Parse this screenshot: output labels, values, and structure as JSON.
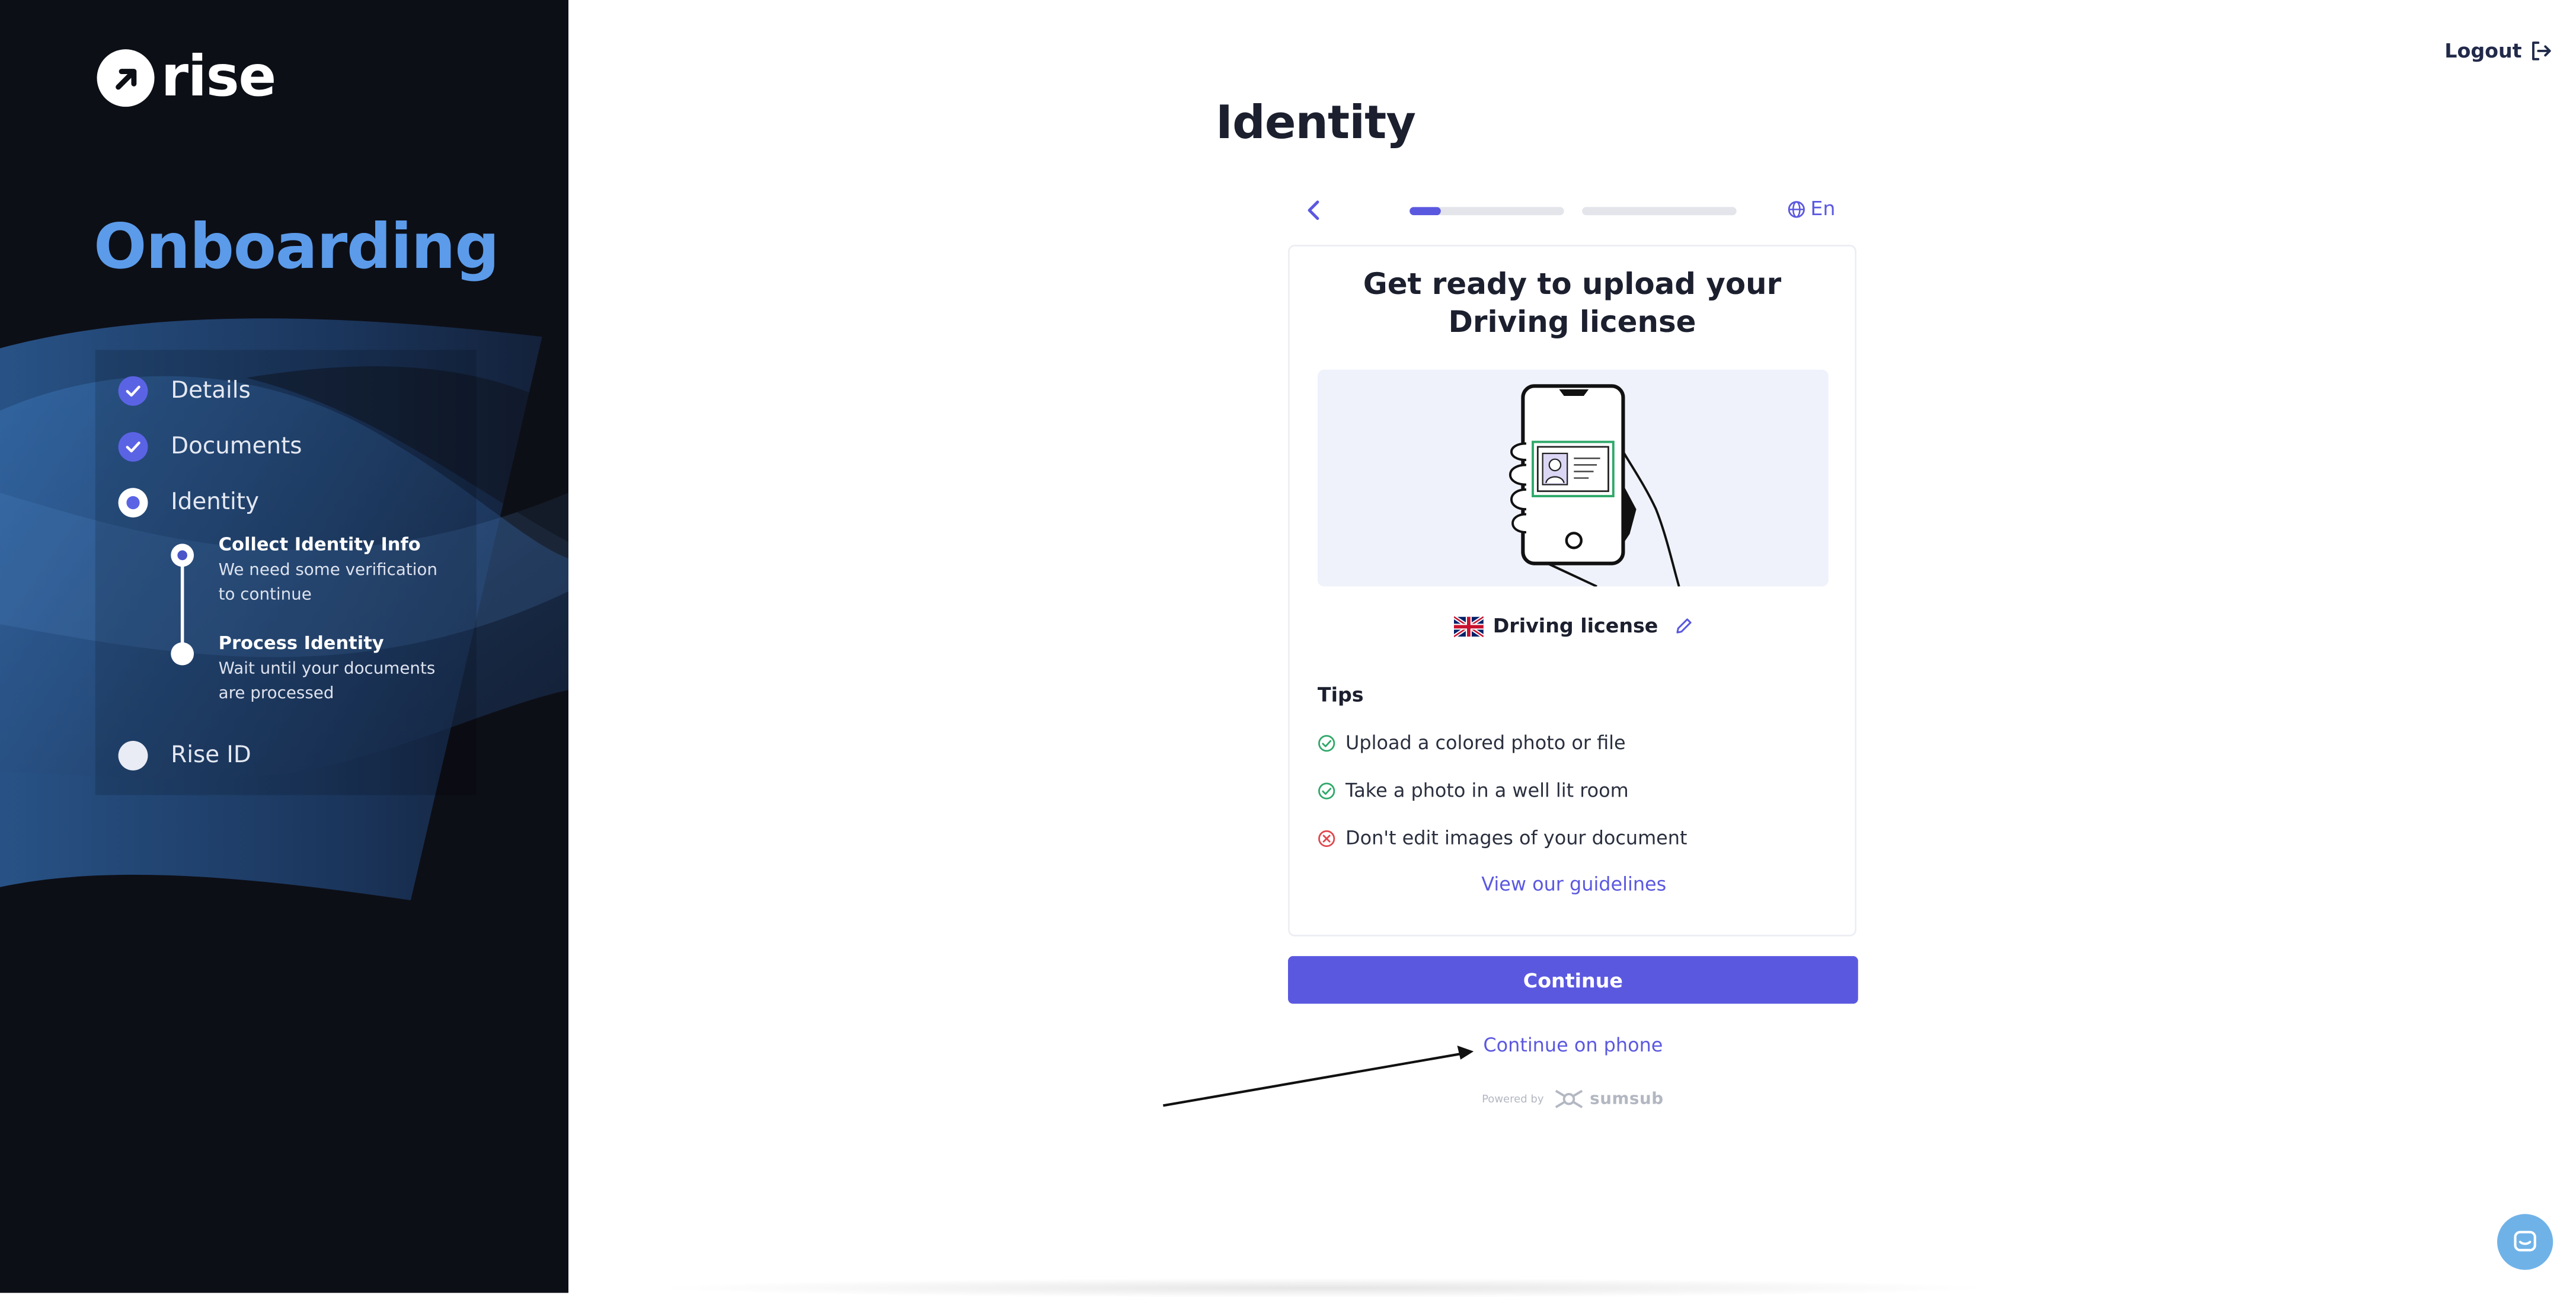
{
  "sidebar": {
    "logo_text": "rise",
    "title": "Onboarding",
    "steps": [
      {
        "label": "Details",
        "state": "done"
      },
      {
        "label": "Documents",
        "state": "done"
      },
      {
        "label": "Identity",
        "state": "current"
      },
      {
        "label": "Rise ID",
        "state": "todo"
      }
    ],
    "substeps": [
      {
        "title": "Collect Identity Info",
        "description": "We need some verification to continue",
        "state": "current"
      },
      {
        "title": "Process Identity",
        "description": "Wait until your documents are processed",
        "state": "todo"
      }
    ]
  },
  "header": {
    "logout_label": "Logout",
    "page_title": "Identity"
  },
  "verification": {
    "language": "En",
    "progress": [
      0.2,
      0
    ],
    "heading": "Get ready to upload your Driving license",
    "document_type": "Driving license",
    "tips_title": "Tips",
    "tips": [
      {
        "text": "Upload a colored photo or file",
        "type": "do"
      },
      {
        "text": "Take a photo in a well lit room",
        "type": "do"
      },
      {
        "text": "Don't edit images of your document",
        "type": "dont"
      }
    ],
    "guidelines_link": "View our guidelines",
    "continue_label": "Continue",
    "continue_phone_label": "Continue on phone",
    "powered_by": "Powered by",
    "provider": "sumsub"
  },
  "colors": {
    "sidebar_bg": "#0d0f17",
    "accent": "#5b58e0",
    "title_blue": "#5b9bea",
    "success": "#2fa86a",
    "danger": "#e0474c",
    "chat": "#6fb2e8"
  }
}
